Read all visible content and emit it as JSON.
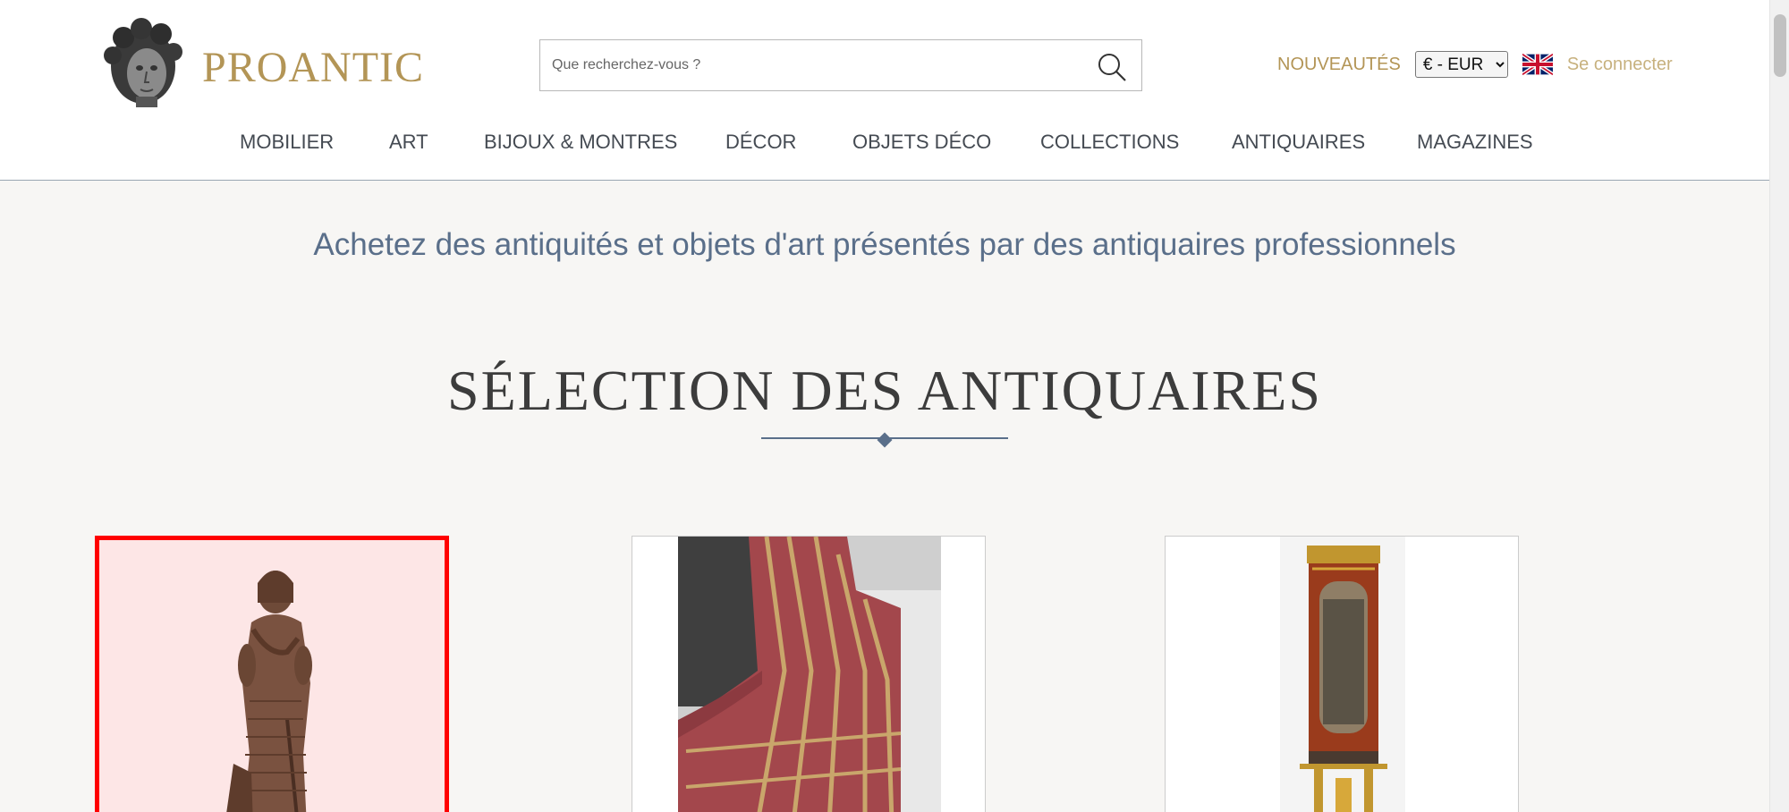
{
  "header": {
    "brand": "PROANTIC",
    "search_placeholder": "Que recherchez-vous ?",
    "new_label": "NOUVEAUTÉS",
    "currency": "€ - EUR",
    "language_flag": "uk-flag-icon",
    "login_label": "Se connecter"
  },
  "nav": {
    "items": [
      {
        "label": "MOBILIER"
      },
      {
        "label": "ART"
      },
      {
        "label": "BIJOUX & MONTRES"
      },
      {
        "label": "DÉCOR"
      },
      {
        "label": "OBJETS DÉCO"
      },
      {
        "label": "COLLECTIONS"
      },
      {
        "label": "ANTIQUAIRES"
      },
      {
        "label": "MAGAZINES"
      }
    ]
  },
  "main": {
    "tagline": "Achetez des antiquités et objets d'art présentés par des antiquaires professionnels",
    "section_title": "SÉLECTION DES ANTIQUAIRES",
    "cards": [
      {
        "image": "bronze-statue-image",
        "selected": true
      },
      {
        "image": "striped-textile-image",
        "selected": false
      },
      {
        "image": "mahogany-mirror-console-image",
        "selected": false
      }
    ]
  },
  "colors": {
    "brand_gold": "#b39556",
    "text_blue": "#5a6f8a",
    "selection_red": "#ff0000"
  }
}
